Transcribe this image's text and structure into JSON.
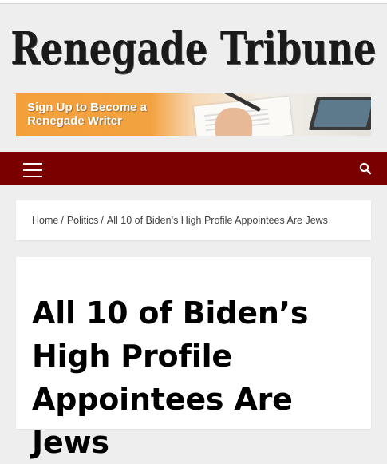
{
  "site": {
    "logo_text": "Renegade Tribune"
  },
  "banner": {
    "line1": "Sign Up to Become a",
    "line2": "Renegade Writer"
  },
  "navbar": {
    "menu_icon": "hamburger-menu-icon",
    "search_icon": "search-icon",
    "background_color": "#7a0000"
  },
  "breadcrumb": {
    "items": [
      {
        "label": "Home"
      },
      {
        "label": "Politics"
      },
      {
        "label": "All 10 of Biden’s High Profile Appointees Are Jews"
      }
    ],
    "separator": "/"
  },
  "article": {
    "title": "All 10 of Biden’s High Profile Appointees Are Jews"
  }
}
